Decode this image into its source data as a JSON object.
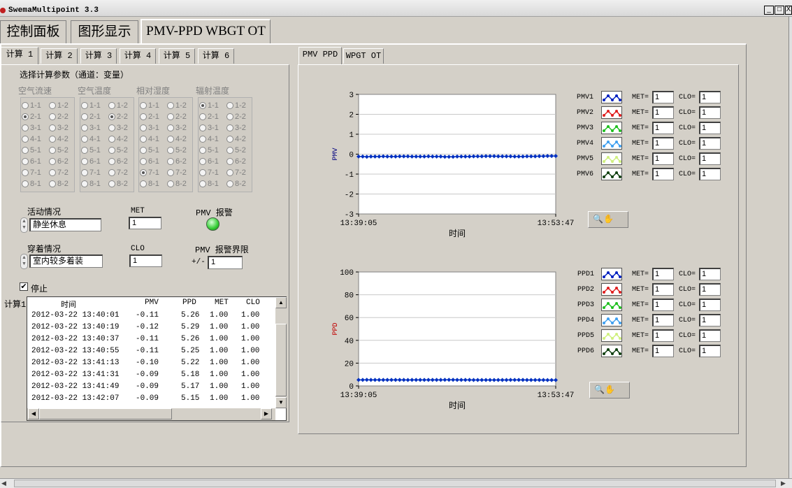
{
  "window": {
    "title": "SwemaMultipoint 3.3"
  },
  "main_tabs": [
    {
      "label": "控制面板"
    },
    {
      "label": "图形显示"
    },
    {
      "label": "PMV-PPD WBGT OT"
    }
  ],
  "calc_tabs": [
    {
      "label": "计算 1"
    },
    {
      "label": "计算 2"
    },
    {
      "label": "计算 3"
    },
    {
      "label": "计算 4"
    },
    {
      "label": "计算 5"
    },
    {
      "label": "计算 6"
    }
  ],
  "params": {
    "title": "选择计算参数（通道：变量）",
    "groups": [
      {
        "label": "空气流速",
        "selected": "2-1"
      },
      {
        "label": "空气温度",
        "selected": "2-2"
      },
      {
        "label": "相对湿度",
        "selected": "7-1"
      },
      {
        "label": "辐射温度",
        "selected": "1-1"
      }
    ],
    "options": [
      "1-1",
      "1-2",
      "2-1",
      "2-2",
      "3-1",
      "3-2",
      "4-1",
      "4-2",
      "5-1",
      "5-2",
      "6-1",
      "6-2",
      "7-1",
      "7-2",
      "8-1",
      "8-2"
    ]
  },
  "activity": {
    "label": "活动情况",
    "value": "静坐休息",
    "met_label": "MET",
    "met_value": "1",
    "alarm_label": "PMV 报警",
    "alarm_color": "#33cc33"
  },
  "clothing": {
    "label": "穿着情况",
    "value": "室内较多着装",
    "clo_label": "CLO",
    "clo_value": "1",
    "limit_label": "PMV 报警界限",
    "limit_prefix": "+/-",
    "limit_value": "1"
  },
  "stop": {
    "label": "停止",
    "checked": true
  },
  "table": {
    "side_label": "计算1",
    "headers": [
      "时间",
      "PMV",
      "PPD",
      "MET",
      "CLO"
    ],
    "rows": [
      [
        "2012-03-22 13:40:01",
        "-0.11",
        "5.26",
        "1.00",
        "1.00"
      ],
      [
        "2012-03-22 13:40:19",
        "-0.12",
        "5.29",
        "1.00",
        "1.00"
      ],
      [
        "2012-03-22 13:40:37",
        "-0.11",
        "5.26",
        "1.00",
        "1.00"
      ],
      [
        "2012-03-22 13:40:55",
        "-0.11",
        "5.25",
        "1.00",
        "1.00"
      ],
      [
        "2012-03-22 13:41:13",
        "-0.10",
        "5.22",
        "1.00",
        "1.00"
      ],
      [
        "2012-03-22 13:41:31",
        "-0.09",
        "5.18",
        "1.00",
        "1.00"
      ],
      [
        "2012-03-22 13:41:49",
        "-0.09",
        "5.17",
        "1.00",
        "1.00"
      ],
      [
        "2012-03-22 13:42:07",
        "-0.09",
        "5.15",
        "1.00",
        "1.00"
      ]
    ]
  },
  "chart_tabs": [
    {
      "label": "PMV PPD"
    },
    {
      "label": "WPGT OT"
    }
  ],
  "chart_data": [
    {
      "type": "line",
      "xlabel": "时间",
      "ylabel": "PMV",
      "ylabel_color": "#000080",
      "ylim": [
        -3,
        3
      ],
      "yticks": [
        "3",
        "2",
        "1",
        "0",
        "-1",
        "-2",
        "-3"
      ],
      "xticks": [
        "13:39:05",
        "13:53:47"
      ],
      "grid": true,
      "line_color": "#0030c0",
      "series": [
        {
          "name": "PMV1",
          "color": "#0020c0"
        }
      ],
      "values": [
        -0.12,
        -0.12,
        -0.13,
        -0.12,
        -0.12,
        -0.12,
        -0.11,
        -0.12,
        -0.12,
        -0.12,
        -0.11,
        -0.11,
        -0.11,
        -0.12,
        -0.12,
        -0.12,
        -0.12,
        -0.11,
        -0.12,
        -0.12,
        -0.12,
        -0.13,
        -0.13,
        -0.13,
        -0.12,
        -0.12,
        -0.12,
        -0.12,
        -0.11,
        -0.11,
        -0.11,
        -0.1,
        -0.1,
        -0.1,
        -0.11,
        -0.11,
        -0.11,
        -0.11,
        -0.12,
        -0.12,
        -0.12,
        -0.11,
        -0.11,
        -0.11,
        -0.1,
        -0.1,
        -0.09,
        -0.09,
        -0.09
      ]
    },
    {
      "type": "line",
      "xlabel": "时间",
      "ylabel": "PPD",
      "ylabel_color": "#c00000",
      "ylim": [
        0,
        100
      ],
      "yticks": [
        "100",
        "80",
        "60",
        "40",
        "20",
        "0"
      ],
      "xticks": [
        "13:39:05",
        "13:53:47"
      ],
      "grid": true,
      "line_color": "#0030c0",
      "series": [
        {
          "name": "PPD1",
          "color": "#0020c0"
        }
      ],
      "values": [
        5.29,
        5.29,
        5.33,
        5.3,
        5.29,
        5.28,
        5.26,
        5.28,
        5.29,
        5.28,
        5.26,
        5.26,
        5.25,
        5.28,
        5.29,
        5.29,
        5.28,
        5.26,
        5.28,
        5.29,
        5.3,
        5.33,
        5.34,
        5.33,
        5.3,
        5.29,
        5.28,
        5.27,
        5.25,
        5.24,
        5.23,
        5.21,
        5.2,
        5.21,
        5.23,
        5.24,
        5.25,
        5.26,
        5.28,
        5.29,
        5.27,
        5.25,
        5.24,
        5.22,
        5.2,
        5.19,
        5.17,
        5.16,
        5.15
      ]
    }
  ],
  "pmv_legend": [
    {
      "name": "PMV1",
      "color": "#0020c0",
      "met": "1",
      "clo": "1"
    },
    {
      "name": "PMV2",
      "color": "#e02020",
      "met": "1",
      "clo": "1"
    },
    {
      "name": "PMV3",
      "color": "#20c020",
      "met": "1",
      "clo": "1"
    },
    {
      "name": "PMV4",
      "color": "#40a0f0",
      "met": "1",
      "clo": "1"
    },
    {
      "name": "PMV5",
      "color": "#d0f080",
      "met": "1",
      "clo": "1"
    },
    {
      "name": "PMV6",
      "color": "#104010",
      "met": "1",
      "clo": "1"
    }
  ],
  "ppd_legend": [
    {
      "name": "PPD1",
      "color": "#0020c0",
      "met": "1",
      "clo": "1"
    },
    {
      "name": "PPD2",
      "color": "#e02020",
      "met": "1",
      "clo": "1"
    },
    {
      "name": "PPD3",
      "color": "#20c020",
      "met": "1",
      "clo": "1"
    },
    {
      "name": "PPD4",
      "color": "#40a0f0",
      "met": "1",
      "clo": "1"
    },
    {
      "name": "PPD5",
      "color": "#d0f080",
      "met": "1",
      "clo": "1"
    },
    {
      "name": "PPD6",
      "color": "#104010",
      "met": "1",
      "clo": "1"
    }
  ],
  "legend_labels": {
    "met": "MET=",
    "clo": "CLO="
  }
}
